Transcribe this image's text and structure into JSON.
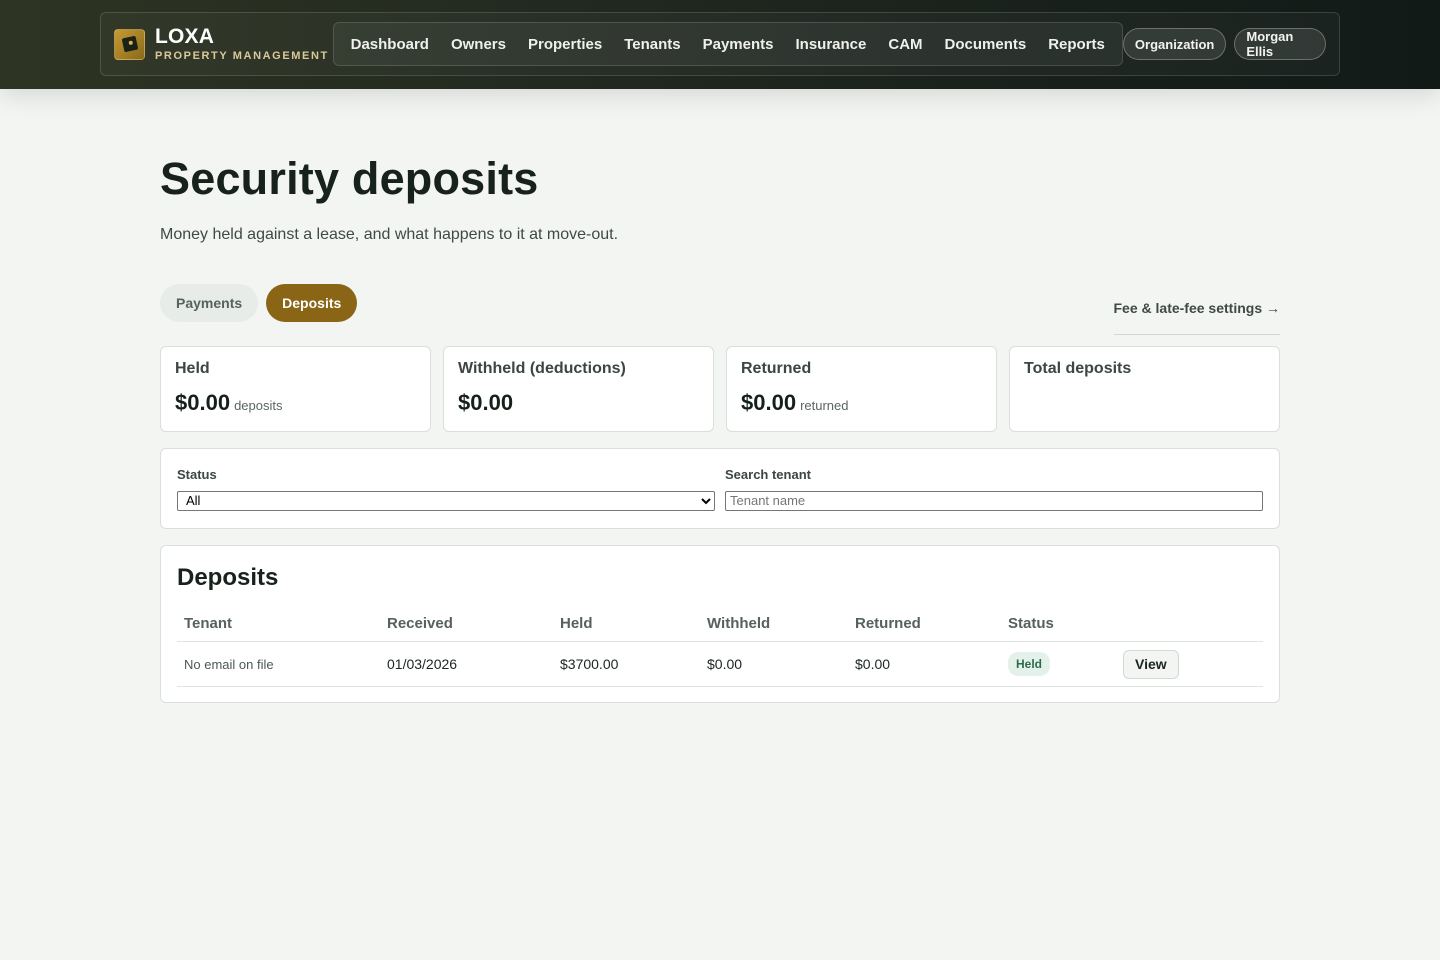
{
  "brand": {
    "name": "LOXA",
    "sub": "PROPERTY MANAGEMENT",
    "icon": "loxa-logo-icon"
  },
  "nav": {
    "items": [
      "Dashboard",
      "Owners",
      "Properties",
      "Tenants",
      "Payments",
      "Insurance",
      "CAM",
      "Documents",
      "Reports"
    ],
    "organization": "Organization",
    "user": "Morgan Ellis"
  },
  "page": {
    "title": "Security deposits",
    "subtitle": "Money held against a lease, and what happens to it at move-out."
  },
  "tabs": {
    "payments": "Payments",
    "deposits": "Deposits",
    "active": "Deposits"
  },
  "fee_link": "Fee & late-fee settings →",
  "cards": {
    "held": {
      "label": "Held",
      "value": "$0.00",
      "unit": "deposits"
    },
    "withheld": {
      "label": "Withheld (deductions)",
      "value": "$0.00"
    },
    "returned": {
      "label": "Returned",
      "value": "$0.00",
      "unit": "returned"
    },
    "total": {
      "label": "Total deposits"
    }
  },
  "filters": {
    "status_label": "Status",
    "status_value": "All",
    "search_label": "Search tenant",
    "search_placeholder": "Tenant name"
  },
  "deposits": {
    "title": "Deposits",
    "columns": [
      "Tenant",
      "Received",
      "Held",
      "Withheld",
      "Returned",
      "Status"
    ],
    "rows": [
      {
        "tenant": "No email on file",
        "received": "01/03/2026",
        "held": "$3700.00",
        "withheld": "$0.00",
        "returned": "$0.00",
        "status": "Held",
        "action": "View"
      }
    ]
  },
  "colors": {
    "accent": "#8a6516",
    "badge_bg": "#e4f1ea",
    "badge_text": "#2d6b4e",
    "topbar": "#1d251e"
  }
}
